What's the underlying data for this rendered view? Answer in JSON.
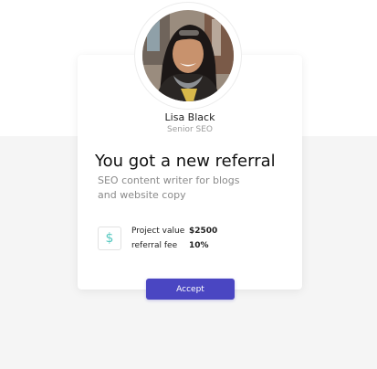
{
  "profile": {
    "name": "Lisa Black",
    "role": "Senior SEO",
    "avatar": "avatar-photo"
  },
  "referral": {
    "headline": "You got a new referral",
    "description": "SEO content writer for blogs and website copy",
    "icon": "dollar-icon",
    "icon_glyph": "$",
    "details": [
      {
        "label": "Project value",
        "value": "$2500"
      },
      {
        "label": "referral fee",
        "value": "10%"
      }
    ]
  },
  "actions": {
    "accept_label": "Accept"
  },
  "colors": {
    "accent": "#4a46c2",
    "icon": "#58c9c1",
    "background": "#f5f5f5"
  }
}
